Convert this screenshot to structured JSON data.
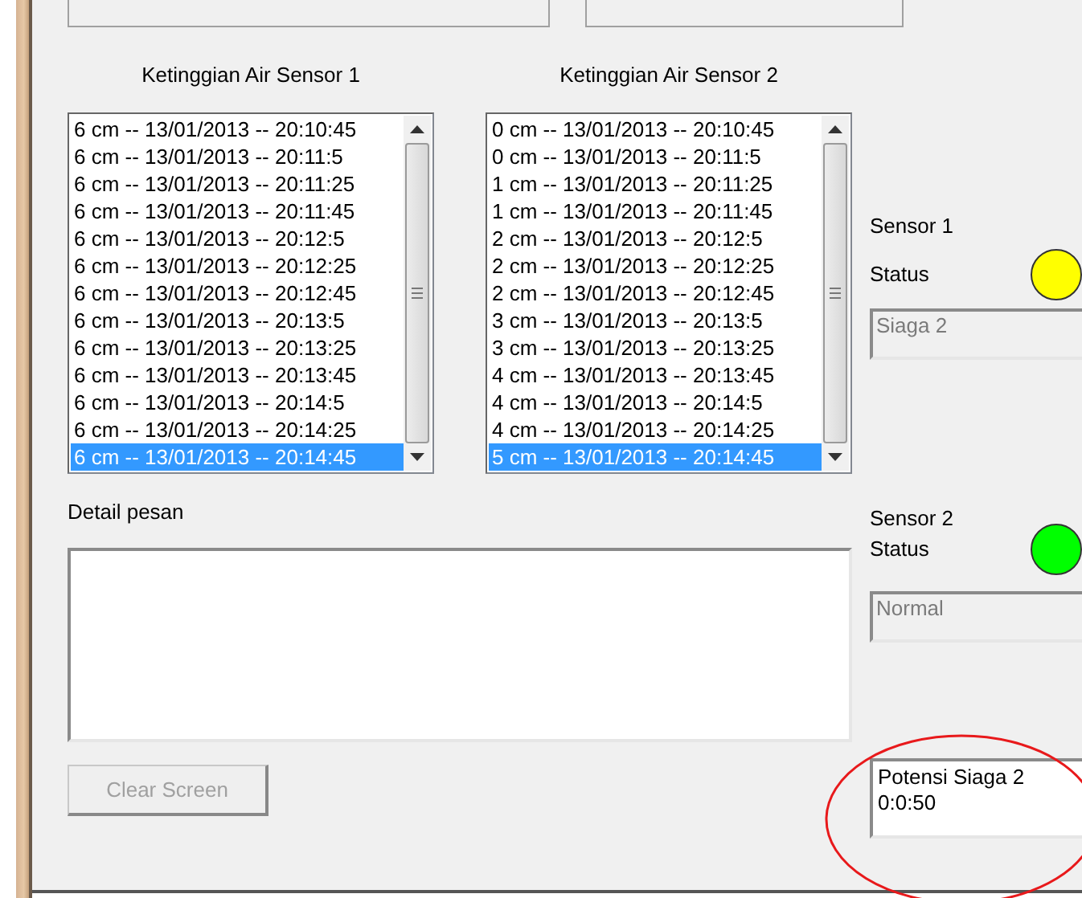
{
  "listboxes": [
    {
      "label": "Ketinggian Air Sensor 1",
      "items": [
        {
          "text": "6 cm -- 13/01/2013 -- 20:10:45",
          "selected": false
        },
        {
          "text": "6 cm -- 13/01/2013 -- 20:11:5",
          "selected": false
        },
        {
          "text": "6 cm -- 13/01/2013 -- 20:11:25",
          "selected": false
        },
        {
          "text": "6 cm -- 13/01/2013 -- 20:11:45",
          "selected": false
        },
        {
          "text": "6 cm -- 13/01/2013 -- 20:12:5",
          "selected": false
        },
        {
          "text": "6 cm -- 13/01/2013 -- 20:12:25",
          "selected": false
        },
        {
          "text": "6 cm -- 13/01/2013 -- 20:12:45",
          "selected": false
        },
        {
          "text": "6 cm -- 13/01/2013 -- 20:13:5",
          "selected": false
        },
        {
          "text": "6 cm -- 13/01/2013 -- 20:13:25",
          "selected": false
        },
        {
          "text": "6 cm -- 13/01/2013 -- 20:13:45",
          "selected": false
        },
        {
          "text": "6 cm -- 13/01/2013 -- 20:14:5",
          "selected": false
        },
        {
          "text": "6 cm -- 13/01/2013 -- 20:14:25",
          "selected": false
        },
        {
          "text": "6 cm -- 13/01/2013 -- 20:14:45",
          "selected": true
        }
      ]
    },
    {
      "label": "Ketinggian Air Sensor 2",
      "items": [
        {
          "text": "0 cm -- 13/01/2013 -- 20:10:45",
          "selected": false
        },
        {
          "text": "0 cm -- 13/01/2013 -- 20:11:5",
          "selected": false
        },
        {
          "text": "1 cm -- 13/01/2013 -- 20:11:25",
          "selected": false
        },
        {
          "text": "1 cm -- 13/01/2013 -- 20:11:45",
          "selected": false
        },
        {
          "text": "2 cm -- 13/01/2013 -- 20:12:5",
          "selected": false
        },
        {
          "text": "2 cm -- 13/01/2013 -- 20:12:25",
          "selected": false
        },
        {
          "text": "2 cm -- 13/01/2013 -- 20:12:45",
          "selected": false
        },
        {
          "text": "3 cm -- 13/01/2013 -- 20:13:5",
          "selected": false
        },
        {
          "text": "3 cm -- 13/01/2013 -- 20:13:25",
          "selected": false
        },
        {
          "text": "4 cm -- 13/01/2013 -- 20:13:45",
          "selected": false
        },
        {
          "text": "4 cm -- 13/01/2013 -- 20:14:5",
          "selected": false
        },
        {
          "text": "4 cm -- 13/01/2013 -- 20:14:25",
          "selected": false
        },
        {
          "text": "5 cm -- 13/01/2013 -- 20:14:45",
          "selected": true
        }
      ]
    }
  ],
  "detail": {
    "label": "Detail pesan"
  },
  "clear_button": {
    "label": "Clear Screen",
    "disabled": true
  },
  "sensors": [
    {
      "name": "Sensor 1",
      "status_label": "Status",
      "color": "#ffff00",
      "value": "Siaga 2",
      "disabled": true
    },
    {
      "name": "Sensor 2",
      "status_label": "Status",
      "color": "#00ff00",
      "value": "Normal",
      "disabled": true
    }
  ],
  "alert": {
    "lines": [
      "Potensi Siaga 2",
      "0:0:50"
    ]
  },
  "annotation": {
    "kind": "ellipse",
    "color": "#e8191b"
  }
}
